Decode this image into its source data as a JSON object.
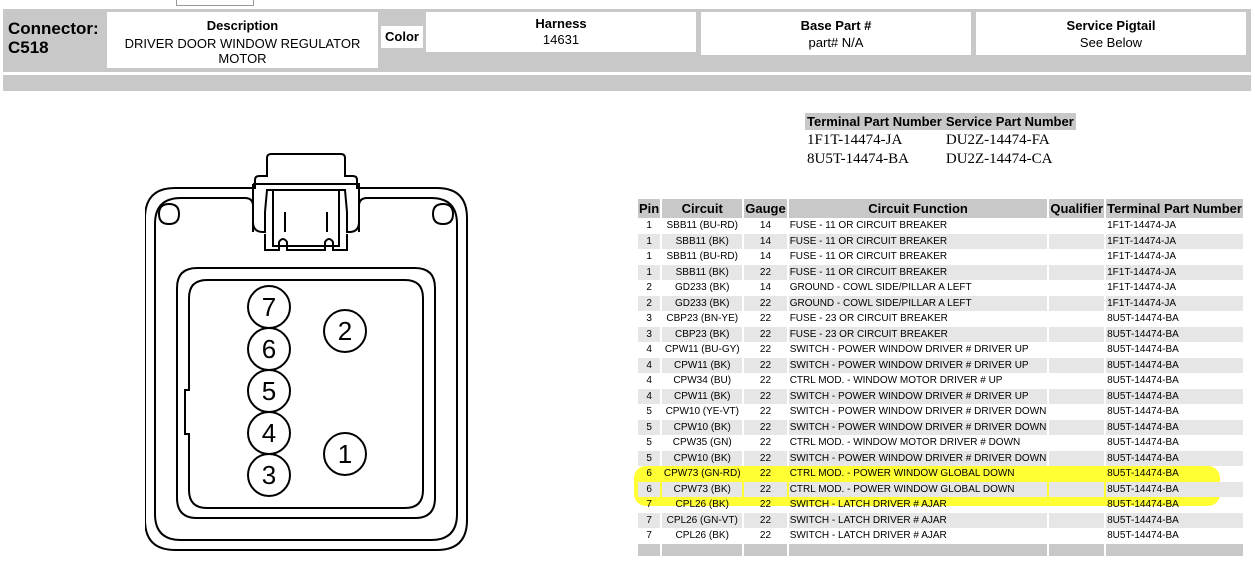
{
  "connector": {
    "label_line1": "Connector:",
    "label_line2": "C518"
  },
  "header": {
    "description_title": "Description",
    "description_value": "DRIVER DOOR WINDOW REGULATOR MOTOR",
    "color_label": "Color",
    "harness_title": "Harness",
    "harness_value": "14631",
    "base_part_title": "Base Part #",
    "base_part_value": "part# N/A",
    "service_pigtail_title": "Service Pigtail",
    "service_pigtail_value": "See Below"
  },
  "diagram": {
    "pins_left": [
      "7",
      "6",
      "5",
      "4",
      "3"
    ],
    "pin_right_top": "2",
    "pin_right_bottom": "1"
  },
  "part_numbers": {
    "headers": [
      "Terminal Part Number",
      "Service Part Number"
    ],
    "rows": [
      [
        "1F1T-14474-JA",
        "DU2Z-14474-FA"
      ],
      [
        "8U5T-14474-BA",
        "DU2Z-14474-CA"
      ]
    ]
  },
  "pin_table": {
    "headers": [
      "Pin",
      "Circuit",
      "Gauge",
      "Circuit Function",
      "Qualifier",
      "Terminal Part Number"
    ],
    "rows": [
      {
        "pin": "1",
        "circuit": "SBB11 (BU-RD)",
        "gauge": "14",
        "function": "FUSE - 11 OR CIRCUIT BREAKER",
        "qualifier": "",
        "terminal": "1F1T-14474-JA"
      },
      {
        "pin": "1",
        "circuit": "SBB11 (BK)",
        "gauge": "14",
        "function": "FUSE - 11 OR CIRCUIT BREAKER",
        "qualifier": "",
        "terminal": "1F1T-14474-JA"
      },
      {
        "pin": "1",
        "circuit": "SBB11 (BU-RD)",
        "gauge": "14",
        "function": "FUSE - 11 OR CIRCUIT BREAKER",
        "qualifier": "",
        "terminal": "1F1T-14474-JA"
      },
      {
        "pin": "1",
        "circuit": "SBB11 (BK)",
        "gauge": "22",
        "function": "FUSE - 11 OR CIRCUIT BREAKER",
        "qualifier": "",
        "terminal": "1F1T-14474-JA"
      },
      {
        "pin": "2",
        "circuit": "GD233 (BK)",
        "gauge": "14",
        "function": "GROUND - COWL SIDE/PILLAR A LEFT",
        "qualifier": "",
        "terminal": "1F1T-14474-JA"
      },
      {
        "pin": "2",
        "circuit": "GD233 (BK)",
        "gauge": "22",
        "function": "GROUND - COWL SIDE/PILLAR A LEFT",
        "qualifier": "",
        "terminal": "1F1T-14474-JA"
      },
      {
        "pin": "3",
        "circuit": "CBP23 (BN-YE)",
        "gauge": "22",
        "function": "FUSE - 23 OR CIRCUIT BREAKER",
        "qualifier": "",
        "terminal": "8U5T-14474-BA"
      },
      {
        "pin": "3",
        "circuit": "CBP23 (BK)",
        "gauge": "22",
        "function": "FUSE - 23 OR CIRCUIT BREAKER",
        "qualifier": "",
        "terminal": "8U5T-14474-BA"
      },
      {
        "pin": "4",
        "circuit": "CPW11 (BU-GY)",
        "gauge": "22",
        "function": "SWITCH - POWER WINDOW DRIVER # DRIVER UP",
        "qualifier": "",
        "terminal": "8U5T-14474-BA"
      },
      {
        "pin": "4",
        "circuit": "CPW11 (BK)",
        "gauge": "22",
        "function": "SWITCH - POWER WINDOW DRIVER # DRIVER UP",
        "qualifier": "",
        "terminal": "8U5T-14474-BA"
      },
      {
        "pin": "4",
        "circuit": "CPW34 (BU)",
        "gauge": "22",
        "function": "CTRL MOD. - WINDOW MOTOR DRIVER # UP",
        "qualifier": "",
        "terminal": "8U5T-14474-BA"
      },
      {
        "pin": "4",
        "circuit": "CPW11 (BK)",
        "gauge": "22",
        "function": "SWITCH - POWER WINDOW DRIVER # DRIVER UP",
        "qualifier": "",
        "terminal": "8U5T-14474-BA"
      },
      {
        "pin": "5",
        "circuit": "CPW10 (YE-VT)",
        "gauge": "22",
        "function": "SWITCH - POWER WINDOW DRIVER # DRIVER DOWN",
        "qualifier": "",
        "terminal": "8U5T-14474-BA"
      },
      {
        "pin": "5",
        "circuit": "CPW10 (BK)",
        "gauge": "22",
        "function": "SWITCH - POWER WINDOW DRIVER # DRIVER DOWN",
        "qualifier": "",
        "terminal": "8U5T-14474-BA"
      },
      {
        "pin": "5",
        "circuit": "CPW35 (GN)",
        "gauge": "22",
        "function": "CTRL MOD. - WINDOW MOTOR DRIVER # DOWN",
        "qualifier": "",
        "terminal": "8U5T-14474-BA"
      },
      {
        "pin": "5",
        "circuit": "CPW10 (BK)",
        "gauge": "22",
        "function": "SWITCH - POWER WINDOW DRIVER # DRIVER DOWN",
        "qualifier": "",
        "terminal": "8U5T-14474-BA"
      },
      {
        "pin": "6",
        "circuit": "CPW73 (GN-RD)",
        "gauge": "22",
        "function": "CTRL MOD. - POWER WINDOW GLOBAL DOWN",
        "qualifier": "",
        "terminal": "8U5T-14474-BA"
      },
      {
        "pin": "6",
        "circuit": "CPW73 (BK)",
        "gauge": "22",
        "function": "CTRL MOD. - POWER WINDOW GLOBAL DOWN",
        "qualifier": "",
        "terminal": "8U5T-14474-BA"
      },
      {
        "pin": "7",
        "circuit": "CPL26 (BK)",
        "gauge": "22",
        "function": "SWITCH - LATCH DRIVER # AJAR",
        "qualifier": "",
        "terminal": "8U5T-14474-BA"
      },
      {
        "pin": "7",
        "circuit": "CPL26 (GN-VT)",
        "gauge": "22",
        "function": "SWITCH - LATCH DRIVER # AJAR",
        "qualifier": "",
        "terminal": "8U5T-14474-BA"
      },
      {
        "pin": "7",
        "circuit": "CPL26 (BK)",
        "gauge": "22",
        "function": "SWITCH - LATCH DRIVER # AJAR",
        "qualifier": "",
        "terminal": "8U5T-14474-BA"
      }
    ]
  },
  "colors": {
    "header_gray": "#c8c8c8",
    "row_alt": "#e6e6e6",
    "highlight": "#ffff33"
  }
}
